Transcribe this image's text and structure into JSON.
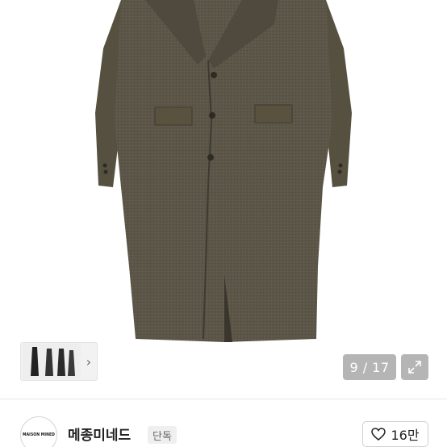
{
  "product": {
    "image_description_icon": "wool-long-coat-photo",
    "coat_color": "#5d574a",
    "coat_color_dark": "#4a463c"
  },
  "gallery": {
    "counter": "9 / 17",
    "expand_icon": "expand-arrows-icon",
    "thumbnail_arrow": "›"
  },
  "shop": {
    "logo_text": "MAISON MINED",
    "name": "메종미네드",
    "badge": "단독",
    "like_icon": "heart-outline-icon",
    "like_count": "16만"
  }
}
